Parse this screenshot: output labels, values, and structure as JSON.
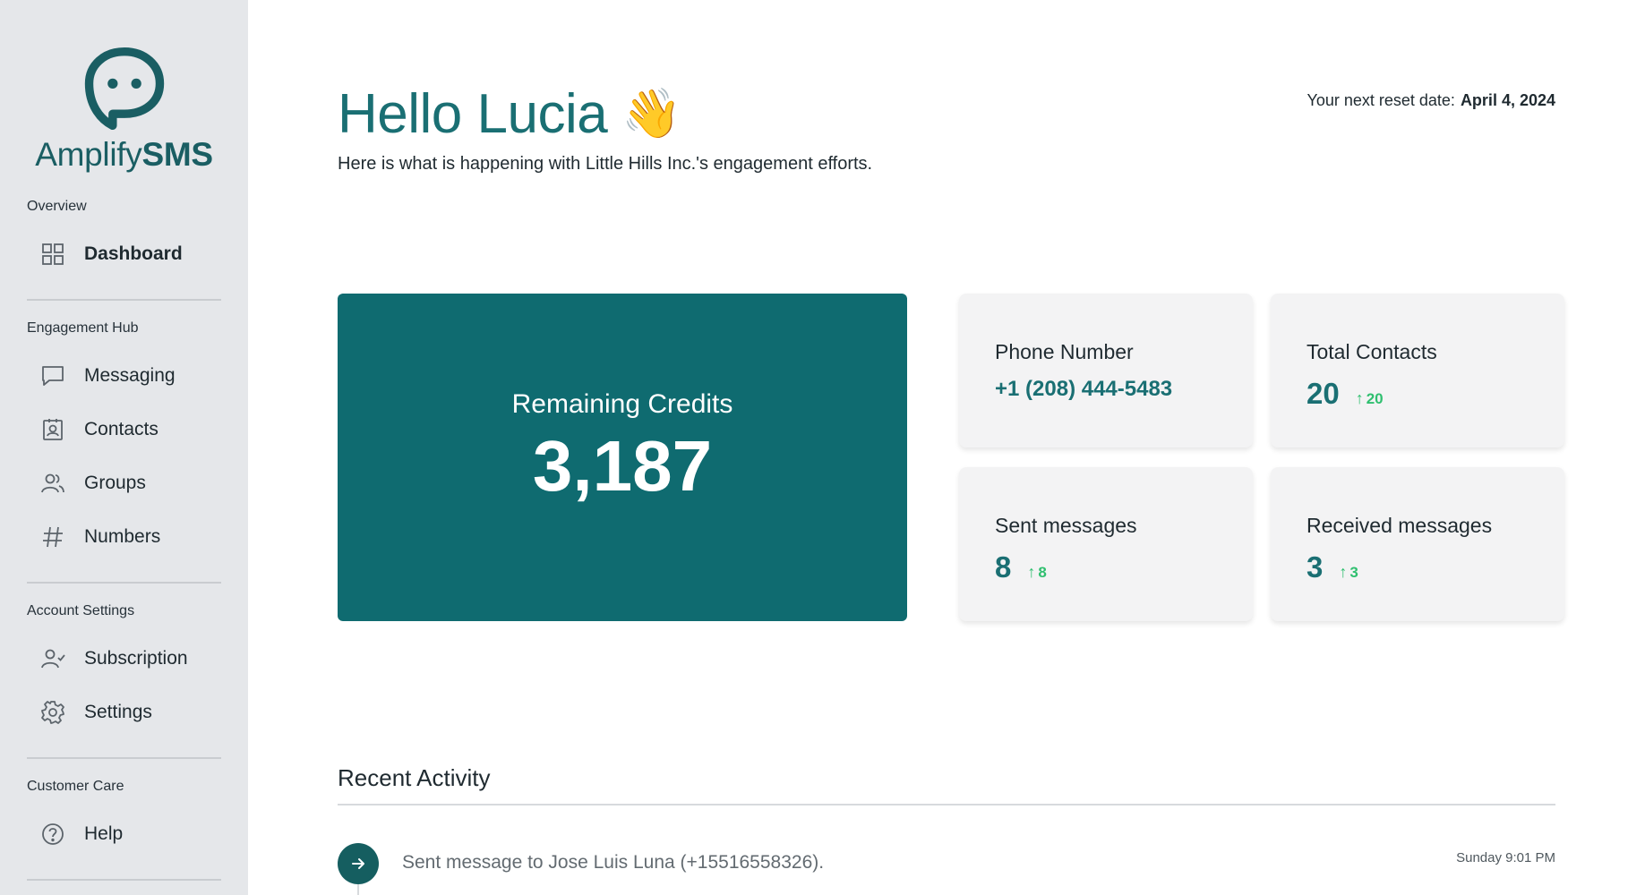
{
  "brand": {
    "name_light": "Amplify",
    "name_bold": "SMS"
  },
  "sidebar": {
    "sections": [
      {
        "title": "Overview",
        "items": [
          {
            "label": "Dashboard",
            "icon": "grid-icon",
            "active": true
          }
        ]
      },
      {
        "title": "Engagement Hub",
        "items": [
          {
            "label": "Messaging",
            "icon": "chat-bubble-icon"
          },
          {
            "label": "Contacts",
            "icon": "contact-card-icon"
          },
          {
            "label": "Groups",
            "icon": "users-icon"
          },
          {
            "label": "Numbers",
            "icon": "hash-icon"
          }
        ]
      },
      {
        "title": "Account Settings",
        "items": [
          {
            "label": "Subscription",
            "icon": "user-check-icon"
          },
          {
            "label": "Settings",
            "icon": "gear-icon"
          }
        ]
      },
      {
        "title": "Customer Care",
        "items": [
          {
            "label": "Help",
            "icon": "help-circle-icon"
          }
        ]
      }
    ]
  },
  "header": {
    "greeting": "Hello Lucia",
    "wave_emoji": "👋",
    "subtitle": "Here is what is happening with Little Hills Inc.'s engagement efforts.",
    "reset_label": "Your next reset date:",
    "reset_date": "April 4, 2024"
  },
  "credits": {
    "label": "Remaining Credits",
    "value": "3,187"
  },
  "stats": {
    "phone": {
      "title": "Phone Number",
      "value": "+1 (208) 444-5483"
    },
    "contacts": {
      "title": "Total Contacts",
      "value": "20",
      "delta": "20"
    },
    "sent": {
      "title": "Sent messages",
      "value": "8",
      "delta": "8"
    },
    "received": {
      "title": "Received messages",
      "value": "3",
      "delta": "3"
    }
  },
  "recent": {
    "title": "Recent Activity",
    "items": [
      {
        "text": "Sent message to Jose Luis Luna (+15516558326).",
        "time": "Sunday 9:01 PM"
      }
    ]
  },
  "colors": {
    "brand": "#1a6f73",
    "credits_bg": "#0f6b70",
    "delta": "#2fbf6f",
    "sidebar_bg": "#e5e7ea"
  }
}
